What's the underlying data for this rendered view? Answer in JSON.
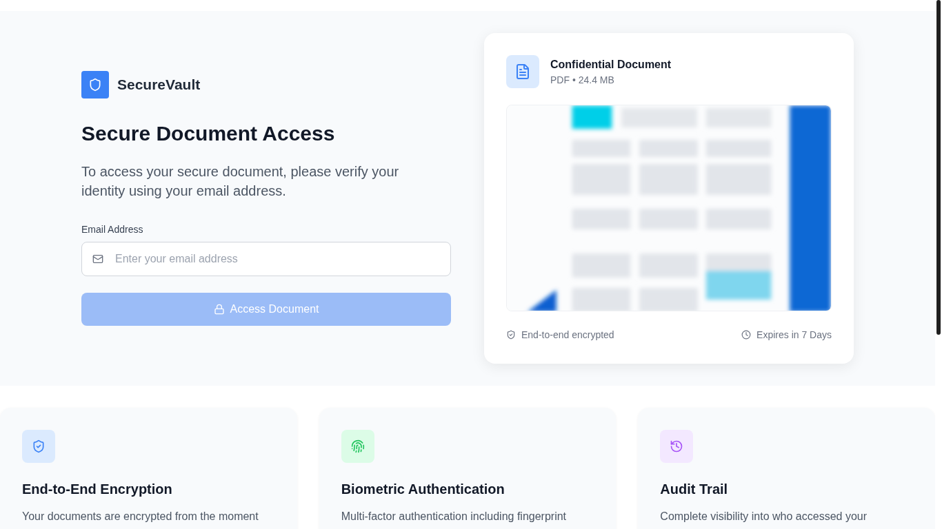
{
  "brand": {
    "name": "SecureVault"
  },
  "hero": {
    "title": "Secure Document Access",
    "subtitle": "To access your secure document, please verify your identity using your email address."
  },
  "email_field": {
    "label": "Email Address",
    "placeholder": "Enter your email address"
  },
  "submit_button": {
    "label": "Access Document",
    "disabled": true
  },
  "document_card": {
    "title": "Confidential Document",
    "meta": "PDF • 24.4 MB",
    "footer": [
      {
        "kind": "shield",
        "text": "End-to-end encrypted"
      },
      {
        "kind": "clock",
        "text": "Expires in 7 Days"
      }
    ]
  },
  "features": [
    {
      "kind": "shield",
      "title": "End-to-End Encryption",
      "description": "Your documents are encrypted from the moment"
    },
    {
      "kind": "fingerprint",
      "title": "Biometric Authentication",
      "description": "Multi-factor authentication including fingerprint"
    },
    {
      "kind": "history",
      "title": "Audit Trail",
      "description": "Complete visibility into who accessed your"
    }
  ]
}
